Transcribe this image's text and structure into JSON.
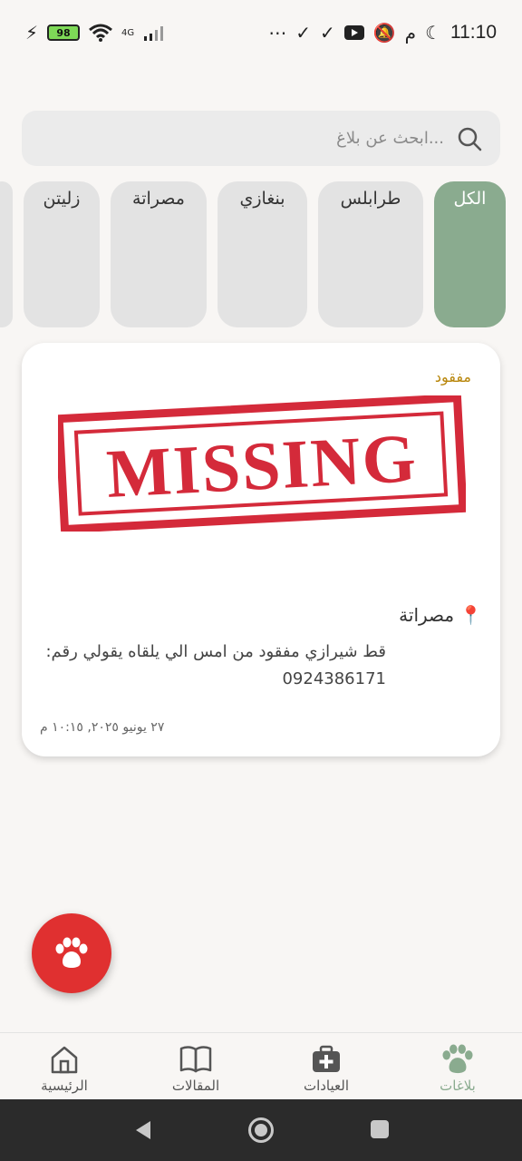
{
  "status_bar": {
    "time": "11:10",
    "am_pm": "م",
    "battery": "98",
    "network": "4G"
  },
  "search": {
    "placeholder": "ابحث عن بلاغ..."
  },
  "chips": [
    {
      "label": "الكل",
      "active": true
    },
    {
      "label": "طرابلس",
      "active": false
    },
    {
      "label": "بنغازي",
      "active": false
    },
    {
      "label": "مصراتة",
      "active": false
    },
    {
      "label": "زليتن",
      "active": false
    }
  ],
  "report": {
    "badge": "مفقود",
    "image_text": "MISSING",
    "location": "مصراتة",
    "location_icon": "pin-icon",
    "description": "قط شيرازي مفقود من امس الي يلقاه يقولي رقم: 0924386171",
    "date": "٢٧ يونيو ٢٠٢٥, ١٠:١٥ م"
  },
  "fab": {
    "icon": "paw-icon"
  },
  "bottom_nav": [
    {
      "label": "بلاغات",
      "icon": "paw-icon",
      "active": true
    },
    {
      "label": "العيادات",
      "icon": "medical-bag-icon",
      "active": false
    },
    {
      "label": "المقالات",
      "icon": "book-icon",
      "active": false
    },
    {
      "label": "الرئيسية",
      "icon": "home-icon",
      "active": false
    }
  ],
  "colors": {
    "accent": "#8aab8f",
    "fab": "#e03030",
    "badge": "#b8860b",
    "stamp": "#d42a3a"
  }
}
